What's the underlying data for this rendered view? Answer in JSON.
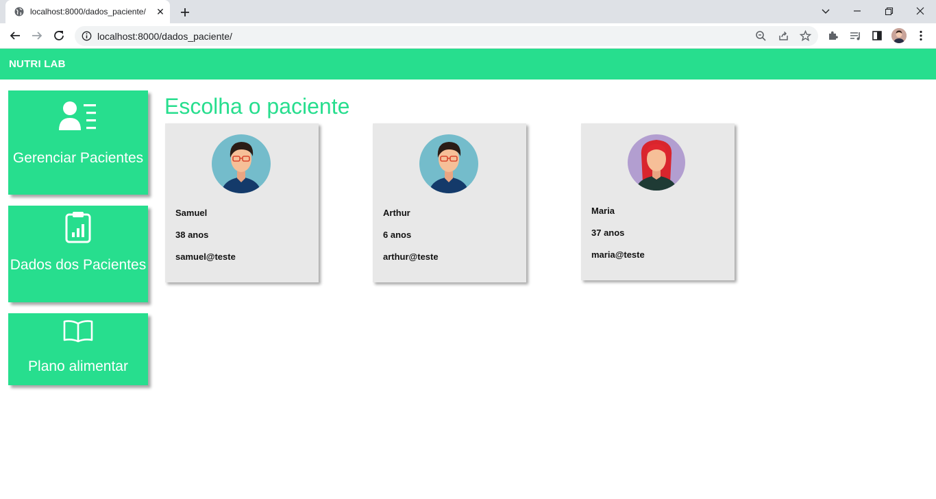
{
  "browser": {
    "tab_title": "localhost:8000/dados_paciente/",
    "tab_close": "✕",
    "url": "localhost:8000/dados_paciente/"
  },
  "navbar": {
    "brand": "NUTRI LAB"
  },
  "sidebar": {
    "items": [
      {
        "label": "Gerenciar Pacientes",
        "icon": "user-list-icon"
      },
      {
        "label": "Dados dos Pacientes",
        "icon": "clipboard-chart-icon"
      },
      {
        "label": "Plano alimentar",
        "icon": "open-book-icon"
      }
    ]
  },
  "main": {
    "title": "Escolha o paciente",
    "patients": [
      {
        "name": "Samuel",
        "age": "38 anos",
        "email": "samuel@teste",
        "avatar": "male-avatar"
      },
      {
        "name": "Arthur",
        "age": "6 anos",
        "email": "arthur@teste",
        "avatar": "male-avatar"
      },
      {
        "name": "Maria",
        "age": "37 anos",
        "email": "maria@teste",
        "avatar": "female-avatar"
      }
    ]
  },
  "colors": {
    "accent": "#27de8e",
    "card_bg": "#e8e8e8",
    "male_avatar_bg": "#74bccb",
    "female_avatar_bg": "#b29ed0"
  }
}
